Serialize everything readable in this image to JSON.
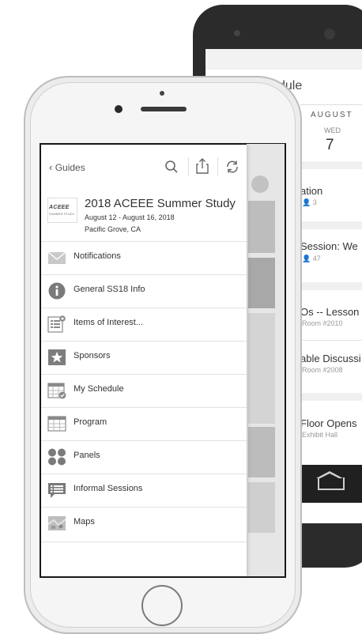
{
  "android": {
    "screen_title": "dule",
    "month": "AUGUST",
    "weekday": "WED",
    "date_number": "7",
    "rows": [
      {
        "title": "ation",
        "sub": "3"
      },
      {
        "title": "Session: We",
        "sub": "47"
      },
      {
        "title": "Os -- Lesson",
        "sub": "Room #2010"
      },
      {
        "title": "able Discussi",
        "sub": "Room #2008"
      },
      {
        "title": "Floor Opens",
        "sub": "Exhibit Hall"
      }
    ]
  },
  "iphone": {
    "toolbar": {
      "back_label": "Guides",
      "search_icon": "search-icon",
      "share_icon": "share-icon",
      "refresh_icon": "refresh-icon"
    },
    "guide": {
      "logo_text": "ACEEE",
      "logo_sub": "SUMMER STUDY",
      "title": "2018 ACEEE Summer Study",
      "dates": "August 12 - August 16, 2018",
      "location": "Pacific Grove, CA"
    },
    "menu": [
      {
        "label": "Notifications",
        "icon": "envelope-icon"
      },
      {
        "label": "General SS18 Info",
        "icon": "info-icon"
      },
      {
        "label": "Items of Interest...",
        "icon": "list-icon"
      },
      {
        "label": "Sponsors",
        "icon": "star-icon"
      },
      {
        "label": "My Schedule",
        "icon": "calendar-check-icon"
      },
      {
        "label": "Program",
        "icon": "calendar-grid-icon"
      },
      {
        "label": "Panels",
        "icon": "circles-icon"
      },
      {
        "label": "Informal Sessions",
        "icon": "chat-icon"
      },
      {
        "label": "Maps",
        "icon": "map-icon"
      }
    ]
  }
}
